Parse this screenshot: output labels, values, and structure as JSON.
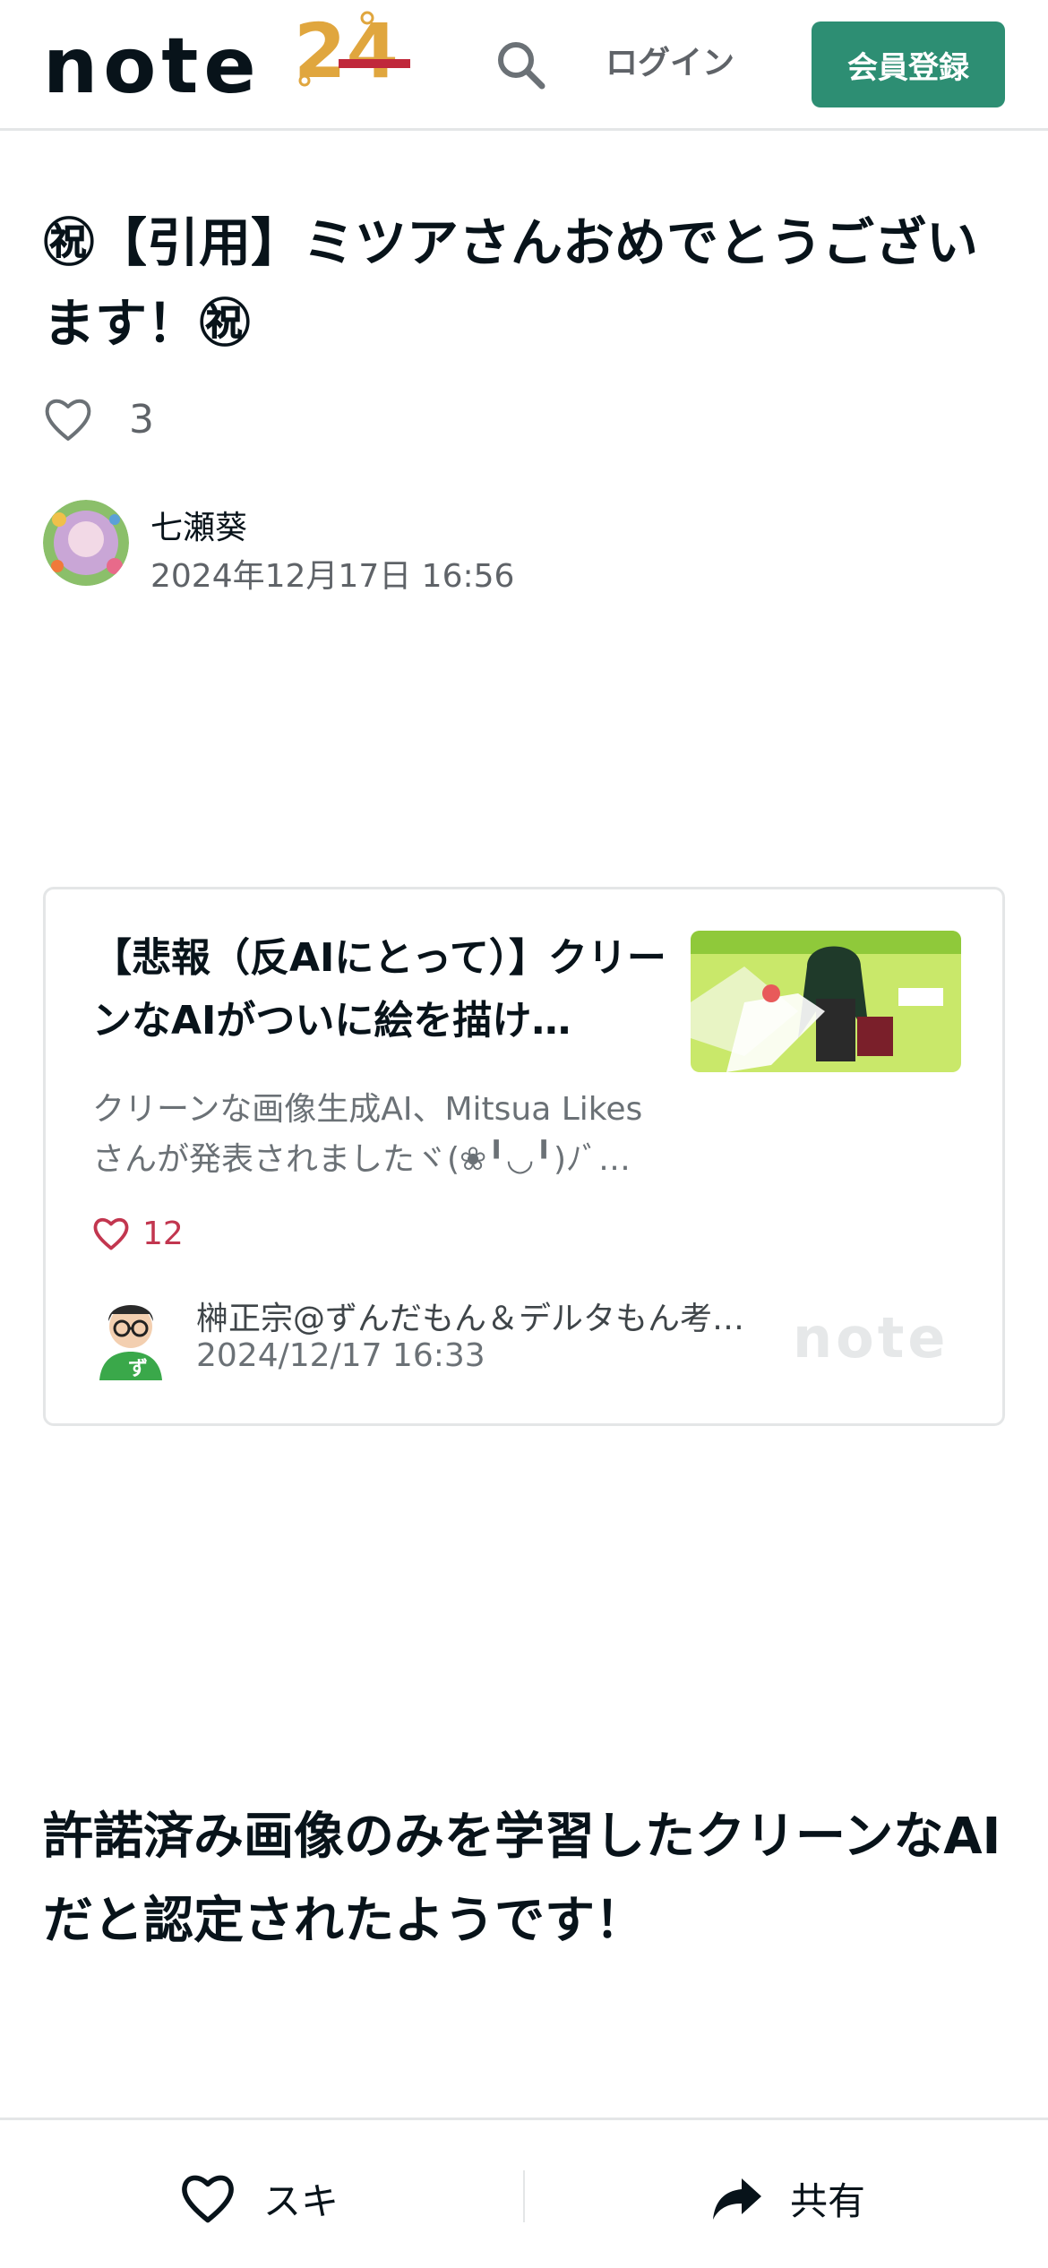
{
  "header": {
    "logo_text": "note",
    "logo_badge": "24",
    "login_label": "ログイン",
    "signup_label": "会員登録",
    "accent_color": "#2d8e73"
  },
  "article": {
    "title": "㊗【引用】ミツアさんおめでとうございます！㊗",
    "like_count": "3",
    "author_name": "七瀬葵",
    "published_at": "2024年12月17日 16:56"
  },
  "embed_card": {
    "title": "【悲報（反AIにとって）】クリーンなAIがついに絵を描け…",
    "description": "クリーンな画像生成AI、Mitsua Likesさんが発表されましたヾ(❀╹◡╹)ﾉﾞ…",
    "like_count": "12",
    "author_name": "榊正宗@ずんだもん＆デルタもん考…",
    "published_at": "2024/12/17 16:33",
    "source_logo": "note",
    "like_color": "#c2364f"
  },
  "body": {
    "heading": "許諾済み画像のみを学習したクリーンなAIだと認定されたようです！"
  },
  "bottom_bar": {
    "like_label": "スキ",
    "share_label": "共有"
  }
}
